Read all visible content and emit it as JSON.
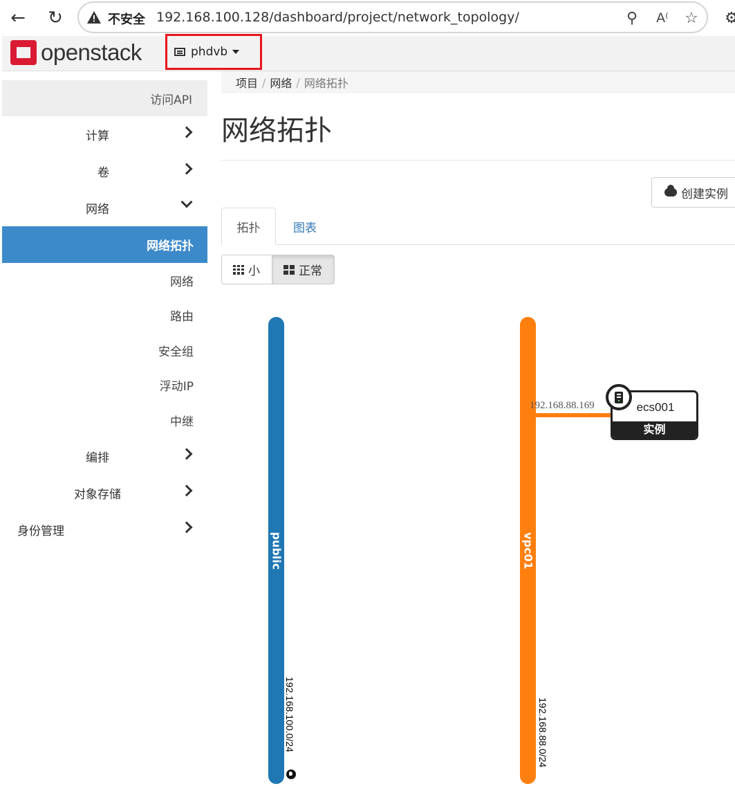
{
  "browser": {
    "insecure_label": "不安全",
    "url": "192.168.100.128/dashboard/project/network_topology/"
  },
  "header": {
    "logo_text": "openstack",
    "project_name": "phdvb"
  },
  "sidebar": {
    "api_access": "访问API",
    "compute": "计算",
    "volumes": "卷",
    "network": "网络",
    "network_items": [
      "网络拓扑",
      "网络",
      "路由",
      "安全组",
      "浮动IP",
      "中继"
    ],
    "orchestration": "编排",
    "object_store": "对象存储",
    "identity": "身份管理"
  },
  "breadcrumb": [
    "项目",
    "网络",
    "网络拓扑"
  ],
  "page": {
    "title": "网络拓扑",
    "create_instance": "创建实例",
    "tabs": [
      "拓扑",
      "图表"
    ],
    "view_small": "小",
    "view_normal": "正常"
  },
  "topology": {
    "networks": [
      {
        "name": "public",
        "cidr": "192.168.100.0/24",
        "color": "#1f77b4",
        "external": true
      },
      {
        "name": "vpc01",
        "cidr": "192.168.88.0/24",
        "color": "#ff7f0e",
        "external": false
      }
    ],
    "instance": {
      "name": "ecs001",
      "type_label": "实例",
      "port_ip": "192.168.88.169"
    }
  },
  "colors": {
    "accent": "#3d8acb",
    "highlight_border": "#e8141c",
    "logo_red": "#da1a32"
  }
}
